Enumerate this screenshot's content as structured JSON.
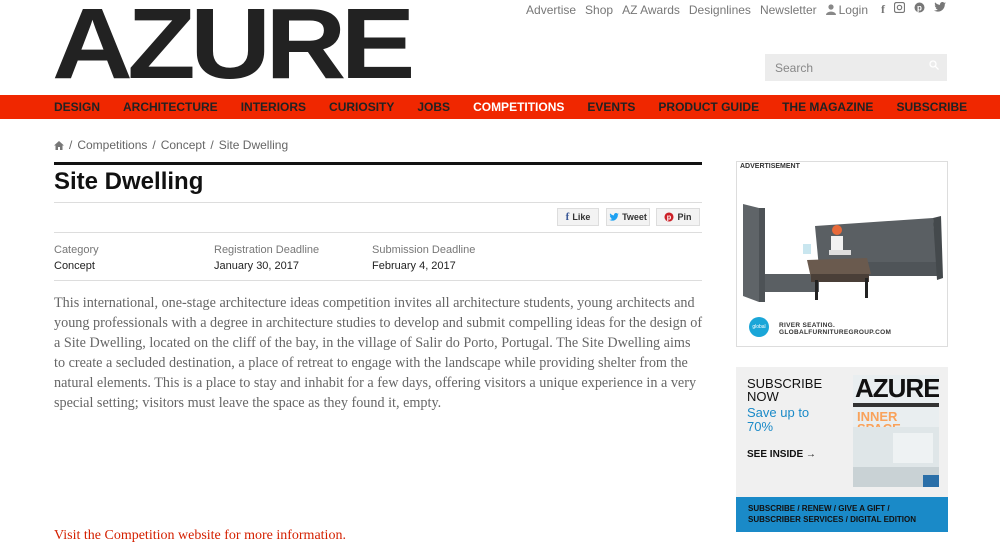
{
  "brand": {
    "logo": "AZURE"
  },
  "top_links": [
    "Advertise",
    "Shop",
    "AZ Awards",
    "Designlines",
    "Newsletter",
    "Login"
  ],
  "social": [
    "f",
    "ig",
    "pinterest",
    "twitter"
  ],
  "search": {
    "placeholder": "Search"
  },
  "nav": [
    {
      "label": "DESIGN",
      "active": false
    },
    {
      "label": "ARCHITECTURE",
      "active": false
    },
    {
      "label": "INTERIORS",
      "active": false
    },
    {
      "label": "CURIOSITY",
      "active": false
    },
    {
      "label": "JOBS",
      "active": false
    },
    {
      "label": "COMPETITIONS",
      "active": true
    },
    {
      "label": "EVENTS",
      "active": false
    },
    {
      "label": "PRODUCT GUIDE",
      "active": false
    },
    {
      "label": "THE MAGAZINE",
      "active": false
    },
    {
      "label": "SUBSCRIBE",
      "active": false
    }
  ],
  "breadcrumb": [
    "Competitions",
    "Concept",
    "Site Dwelling"
  ],
  "title": "Site Dwelling",
  "share": {
    "like": "Like",
    "tweet": "Tweet",
    "pin": "Pin"
  },
  "meta": {
    "category_label": "Category",
    "category_value": "Concept",
    "registration_label": "Registration Deadline",
    "registration_value": "January 30, 2017",
    "submission_label": "Submission Deadline",
    "submission_value": "February 4, 2017"
  },
  "body": "This international, one-stage architecture ideas competition invites all architecture students, young architects and young professionals with a degree in architecture studies to develop and submit compelling ideas for the design of a Site Dwelling, located on the cliff of the bay, in the village of Salir do Porto, Portugal. The Site Dwelling aims to create a secluded destination, a place of retreat to engage with the landscape while providing shelter from the natural elements. This is a place to stay and inhabit for a few days, offering visitors a unique experience in a very special setting; visitors must leave the space as they found it, empty.",
  "visit_link": "Visit the Competition website for more information.",
  "ad": {
    "label": "ADVERTISEMENT",
    "badge": "global",
    "footer": "RIVER SEATING.  GLOBALFURNITUREGROUP.COM"
  },
  "subscribe": {
    "title_1": "SUBSCRIBE",
    "title_2": "NOW",
    "save": "Save up to 70%",
    "see_inside": "SEE INSIDE",
    "mag_logo": "AZURE",
    "mag_inner_1": "INNER",
    "mag_inner_2": "SPACE",
    "band_1": "SUBSCRIBE / RENEW / GIVE A GIFT /",
    "band_2": "SUBSCRIBER SERVICES / DIGITAL EDITION"
  },
  "colors": {
    "accent": "#f02700",
    "link_blue": "#1a8ac8"
  }
}
